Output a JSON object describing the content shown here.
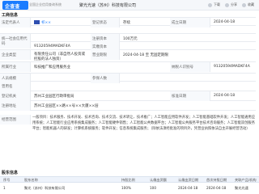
{
  "header": {
    "logo_text": "企查查",
    "logo_sub": "全国企业信用查询系统",
    "company_name": "聚光光速（苏州）科技有限公司",
    "actions": [
      "下载",
      "分享",
      "收藏"
    ]
  },
  "basic_info": {
    "section_title": "工商信息",
    "rows": [
      {
        "label": "法定代表人",
        "value": "祁××",
        "label2": "登记状态",
        "value2": "存续"
      },
      {
        "label": "",
        "value": "",
        "label2": "成立日期",
        "value2": "2024-04-18"
      },
      {
        "label": "统一社会信用代码",
        "value": "",
        "label2": "注册资本",
        "value2": "100万元"
      },
      {
        "label": "",
        "value": "91320594MADKF4A",
        "label2": "实缴资本",
        "value2": ""
      },
      {
        "label": "企业类型",
        "value": "有限责任公司（非自然人投资或控股的法人独资）",
        "label2": "营业期限",
        "value2": "2024-04-18 至 无固定期限"
      },
      {
        "label": "所属行业",
        "value": "科技推广和应用服务业",
        "label2": "纳税人识别号",
        "value2": "91320594MADKF4A"
      },
      {
        "label": "人员规模",
        "value": "",
        "label2": "参保人数",
        "value2": ""
      },
      {
        "label": "曾用名",
        "value": "",
        "label2": "",
        "value2": ""
      },
      {
        "label": "登记机关",
        "value": "苏州工业园区行政审批局",
        "label2": "核准日期",
        "value2": "2024-04-18"
      },
      {
        "label": "注册地址",
        "value": "苏州工业园区××路××号××大厦××层",
        "label2": "",
        "value2": ""
      }
    ],
    "scope_label": "经营范围",
    "scope_text": "一般项目：技术服务、技术开发、技术咨询、技术交流、技术转让、技术推广；人工智能应用软件开发；人工智能基础软件开发；人工智能通用应用系统；人工智能行业应用系统集成服务；人工智能硬件销售；人工智能公共数据平台；人工智能公共服务平台技术咨询服务；人工智能双创服务平台；智能机器人的研发；计算机系统服务；软件开发；信息系统集成服务；（除依法须经批准的项目外，凭营业执照依法自主开展经营活动）"
  },
  "shareholders": {
    "title": "股东信息",
    "columns": [
      "序号",
      "股东名称",
      "持股比例",
      "认缴出资额",
      "认缴出资日期",
      "首次持股日期",
      "关联产品/机构"
    ],
    "rows": [
      {
        "idx": "1",
        "name": "聚光（苏州）科技有限公司",
        "ratio": "100%",
        "amount": "100",
        "date": "2024-04-18",
        "first": "2024-04-18",
        "related": "聚光光速"
      }
    ]
  },
  "colors": {
    "accent": "#1a7cff",
    "header_bg": "#eef3fb"
  }
}
